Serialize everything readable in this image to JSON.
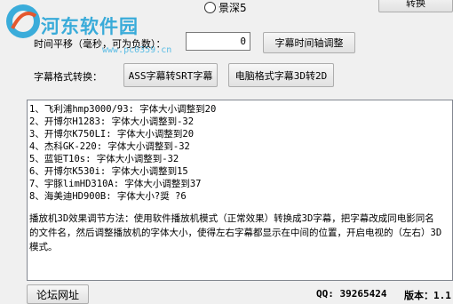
{
  "watermark": {
    "title": "河东软件园",
    "url": "www.pc0359.cn"
  },
  "top": {
    "radio_label": "景深5",
    "convert_label": "转换"
  },
  "timeshift": {
    "label": "时间平移（毫秒，可为负数）：",
    "value": "0",
    "adjust_button": "字幕时间轴调整"
  },
  "format": {
    "label": "字幕格式转换：",
    "ass_to_srt": "ASS字幕转SRT字幕",
    "pc_3d_to_2d": "电脑格式字幕3D转2D"
  },
  "notes": {
    "items": [
      "1、飞利浦hmp3000/93: 字体大小调整到20",
      "2、开博尔H1283: 字体大小调整到-32",
      "3、开博尔K750LI: 字体大小调整到20",
      "4、杰科GK-220: 字体大小调整到-32",
      "5、蓝钜T10s: 字体大小调整到-32",
      "6、开博尔K530i: 字体大小调整到15",
      "7、宇豚limHD310A: 字体大小调整到37",
      "8、海美迪HD900B: 字体大小?奨  ?6"
    ],
    "paragraph": "播放机3D效果调节方法：使用软件播放机模式（正常效果）转换成3D字幕，把字幕改成同电影同名的文件名，然后调整播放机的字体大小，使得左右字幕都显示在中间的位置，开启电视的（左右）3D模式。"
  },
  "footer": {
    "forum_button": "论坛网址",
    "qq": "QQ: 39265424",
    "version": "版本：1.1"
  }
}
